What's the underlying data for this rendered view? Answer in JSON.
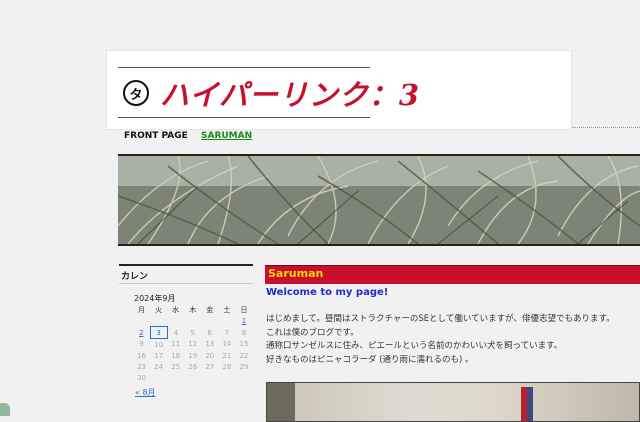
{
  "header": {
    "logo_mark": "タ",
    "logo_text": "ハイパーリンク：3"
  },
  "nav": {
    "items": [
      {
        "label": "FRONT PAGE"
      },
      {
        "label": "SARUMAN"
      }
    ]
  },
  "sidebar": {
    "title": "カレン",
    "calendar": {
      "caption": "2024年9月",
      "weekdays": [
        "月",
        "火",
        "水",
        "木",
        "金",
        "土",
        "日"
      ],
      "weeks": [
        [
          "",
          "",
          "",
          "",
          "",
          "",
          "1"
        ],
        [
          "2",
          "3",
          "4",
          "5",
          "6",
          "7",
          "8"
        ],
        [
          "9",
          "10",
          "11",
          "12",
          "13",
          "14",
          "15"
        ],
        [
          "16",
          "17",
          "18",
          "19",
          "20",
          "21",
          "22"
        ],
        [
          "23",
          "24",
          "25",
          "26",
          "27",
          "28",
          "29"
        ],
        [
          "30",
          "",
          "",
          "",
          "",
          "",
          ""
        ]
      ],
      "prev_link": "« 8月"
    }
  },
  "post": {
    "title": "Saruman",
    "subtitle": "Welcome to my page!",
    "body": [
      "はじめまして。昼間はストラクチャーのSEとして働いていますが、俳優志望でもあります。",
      "これは僕のブログです。",
      "通称口サンゼルスに住み、ピエールという名前のかわいい犬を飼っています。",
      "好きなものはピニャコラーダ (通り雨に濡れるのも) 。"
    ]
  },
  "colors": {
    "accent": "#c8102e",
    "post_title_text": "#ffd400",
    "subtitle": "#1a2ccf",
    "link": "#2a6fc9",
    "nav_active": "#1a8a1a"
  }
}
